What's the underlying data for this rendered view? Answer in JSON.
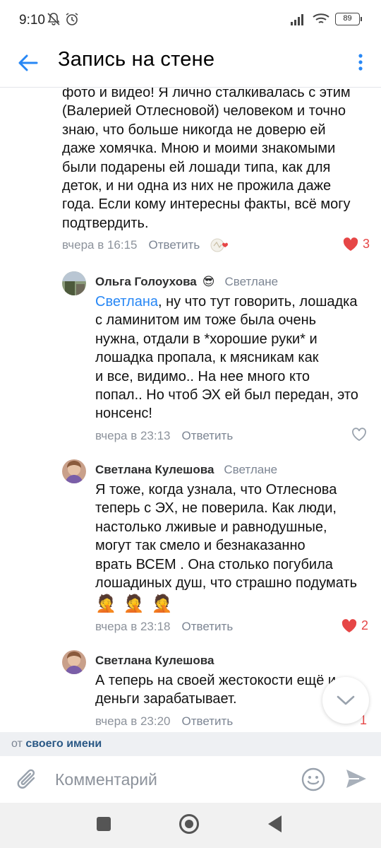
{
  "status": {
    "time": "9:10",
    "battery": "89"
  },
  "header": {
    "title": "Запись на стене",
    "back_icon": "arrow-left-icon",
    "menu_icon": "more-vertical-icon"
  },
  "colors": {
    "accent": "#2787f5",
    "mention": "#2a5885",
    "like_red": "#e64646",
    "meta_gray": "#8c929b"
  },
  "root_comment": {
    "lines": [
      "фото и видео! Я лично сталкивалась с этим",
      "(Валерией Отлесновой) человеком и точно",
      "знаю, что больше никогда не доверю ей",
      "даже хомячка. Мною и моими знакомыми",
      "были подарены ей лошади типа, как для",
      "деток, и ни одна из них не прожила даже",
      "года. Если кому интересны факты, всё могу",
      "подтвердить."
    ],
    "time": "вчера в 16:15",
    "reply_label": "Ответить",
    "likes": "3"
  },
  "replies": [
    {
      "author": "Ольга Голоухова",
      "author_emoji": "😎",
      "to": "Светлане",
      "mention": "Светлана",
      "lines": [
        ", ну что тут говорить, лошадка",
        "с ламинитом им тоже была очень",
        "нужна, отдали в *хорошие руки* и",
        "лошадка пропала, к мясникам как",
        "и все, видимо.. На нее много кто",
        "попал.. Но чтоб ЭХ ей был передан, это",
        "нонсенс!"
      ],
      "time": "вчера в 23:13",
      "reply_label": "Ответить",
      "likes": ""
    },
    {
      "author": "Светлана Кулешова",
      "to": "Светлане",
      "lines": [
        "Я тоже, когда узнала, что Отлеснова",
        "теперь с ЭХ, не поверила. Как люди,",
        "настолько лживые и равнодушные,",
        "могут так смело и безнаказанно",
        "врать ВСЕМ . Она столько погубила",
        "лошадиных душ, что страшно подумать"
      ],
      "emojis": [
        "🤦",
        "🤦",
        "🤦"
      ],
      "time": "вчера в 23:18",
      "reply_label": "Ответить",
      "likes": "2"
    },
    {
      "author": "Светлана Кулешова",
      "lines": [
        "А теперь на своей жестокости ещё и",
        "деньги зарабатывает."
      ],
      "time": "вчера в 23:20",
      "reply_label": "Ответить",
      "likes": "1"
    }
  ],
  "from_bar": {
    "prefix": "от",
    "name": "своего имени"
  },
  "composer": {
    "placeholder": "Комментарий"
  }
}
